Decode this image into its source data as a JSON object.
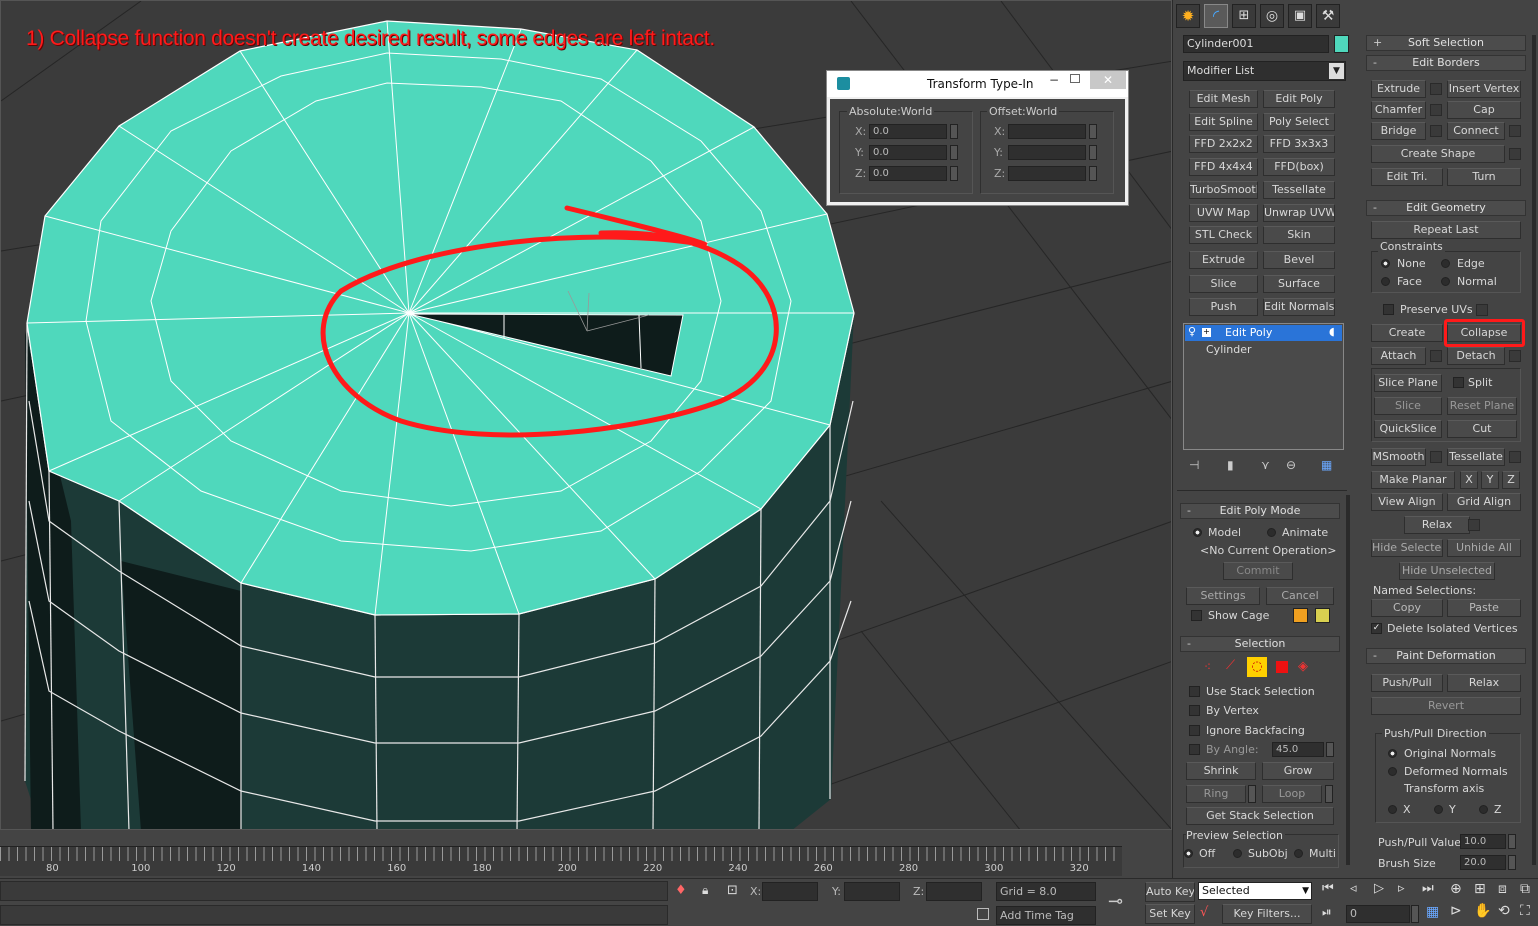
{
  "annotation": "1) Collapse function doesn't create desired result, some edges are left intact.",
  "typein": {
    "title": "Transform Type-In",
    "abs": "Absolute:World",
    "off": "Offset:World",
    "x": "X:",
    "y": "Y:",
    "z": "Z:",
    "xv": "0.0",
    "yv": "0.0",
    "zv": "0.0"
  },
  "cmd": {
    "object_name": "Cylinder001",
    "object_color": "#4fd8bc",
    "modifier_list": "Modifier List",
    "mods": [
      "Edit Mesh",
      "Edit Poly",
      "Edit Spline",
      "Poly Select",
      "FFD 2x2x2",
      "FFD 3x3x3",
      "FFD 4x4x4",
      "FFD(box)",
      "TurboSmooth",
      "Tessellate",
      "UVW Map",
      "Unwrap UVW",
      "STL Check",
      "Skin",
      "Extrude",
      "Bevel",
      "Slice",
      "Surface",
      "Push",
      "Edit Normals"
    ],
    "stack": [
      "Edit Poly",
      "Cylinder"
    ]
  },
  "editpoly": {
    "header": "Edit Poly Mode",
    "model": "Model",
    "animate": "Animate",
    "noop": "<No Current Operation>",
    "commit": "Commit",
    "settings": "Settings",
    "cancel": "Cancel",
    "showcage": "Show Cage"
  },
  "selection": {
    "header": "Selection",
    "use_stack": "Use Stack Selection",
    "by_vertex": "By Vertex",
    "ignore_bf": "Ignore Backfacing",
    "by_angle": "By Angle:",
    "angle": "45.0",
    "shrink": "Shrink",
    "grow": "Grow",
    "ring": "Ring",
    "loop": "Loop",
    "get_stack": "Get Stack Selection",
    "preview": "Preview Selection",
    "off": "Off",
    "subobj": "SubObj",
    "multi": "Multi"
  },
  "right": {
    "soft": "Soft Selection",
    "borders": "Edit Borders",
    "extrude": "Extrude",
    "insert_vertex": "Insert Vertex",
    "chamfer": "Chamfer",
    "cap": "Cap",
    "bridge": "Bridge",
    "connect": "Connect",
    "create_shape": "Create Shape",
    "edit_tri": "Edit Tri.",
    "turn": "Turn",
    "geom": "Edit Geometry",
    "repeat": "Repeat Last",
    "constraints": "Constraints",
    "none": "None",
    "edge": "Edge",
    "face": "Face",
    "normal": "Normal",
    "preserve": "Preserve UVs",
    "create": "Create",
    "collapse": "Collapse",
    "attach": "Attach",
    "detach": "Detach",
    "slice_plane": "Slice Plane",
    "split": "Split",
    "slice": "Slice",
    "reset_plane": "Reset Plane",
    "quickslice": "QuickSlice",
    "cut": "Cut",
    "msmooth": "MSmooth",
    "tessellate": "Tessellate",
    "make_planar": "Make Planar",
    "x": "X",
    "y": "Y",
    "z": "Z",
    "view_align": "View Align",
    "grid_align": "Grid Align",
    "relax": "Relax",
    "hide_sel": "Hide Selected",
    "unhide": "Unhide All",
    "hide_unsel": "Hide Unselected",
    "named": "Named Selections:",
    "copy": "Copy",
    "paste": "Paste",
    "del_iso": "Delete Isolated Vertices",
    "paint": "Paint Deformation",
    "pushpull": "Push/Pull",
    "relax2": "Relax",
    "revert": "Revert",
    "ppdir": "Push/Pull Direction",
    "orig": "Original Normals",
    "deformed": "Deformed Normals",
    "taxis": "Transform axis",
    "ax": "X",
    "ay": "Y",
    "az": "Z",
    "ppval": "Push/Pull Value",
    "ppv": "10.0",
    "brush": "Brush Size",
    "bv": "20.0"
  },
  "timeline": {
    "ticks": [
      "80",
      "100",
      "120",
      "140",
      "160",
      "180",
      "200",
      "220",
      "240",
      "260",
      "280",
      "300",
      "320"
    ]
  },
  "status": {
    "x": "X:",
    "y": "Y:",
    "z": "Z:",
    "grid": "Grid = 8.0",
    "addtime": "Add Time Tag",
    "autokey": "Auto Key",
    "setkey": "Set Key",
    "selected": "Selected",
    "keyfilters": "Key Filters...",
    "frame": "0"
  },
  "colors": {
    "mesh_top": "#4fd8bc",
    "highlight": "#ff1a1a",
    "select_blue": "#2a74d8"
  }
}
